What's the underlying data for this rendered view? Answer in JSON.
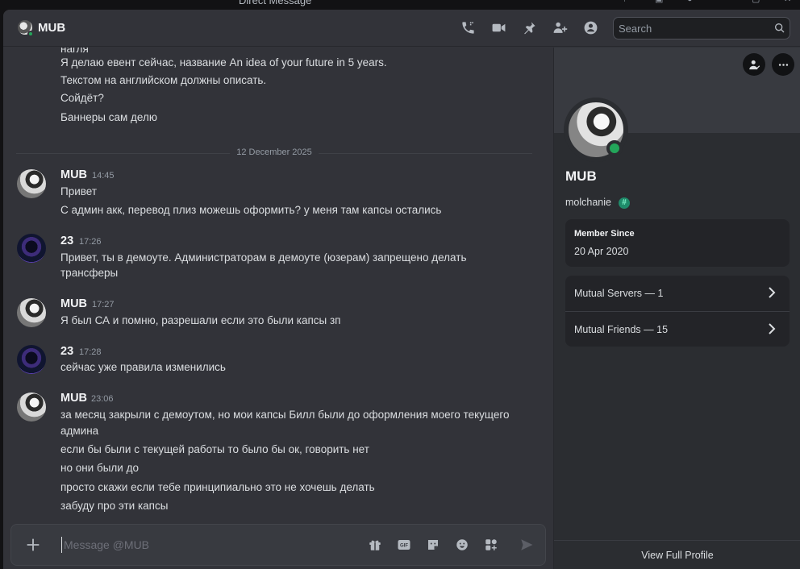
{
  "window": {
    "title": "Direct Message"
  },
  "header": {
    "name": "MUB",
    "icons": [
      "voice-call-icon",
      "video-call-icon",
      "pinned-messages-icon",
      "add-friends-to-dm-icon",
      "user-profile-icon"
    ],
    "search_placeholder": "Search"
  },
  "messages": {
    "partial_lines": [
      "Я делаю евент сейчас, название An idea of your future in 5 years.",
      "Текстом на английском должны описать.",
      "Сойдёт?",
      "Баннеры сам делю"
    ],
    "date_divider": "12 December 2025",
    "groups": [
      {
        "author": "MUB",
        "time": "14:45",
        "lines": [
          "Привет",
          "С админ акк, перевод плиз можешь оформить? у меня там капсы остались"
        ]
      },
      {
        "author": "23",
        "time": "17:26",
        "lines": [
          "Привет, ты в демоуте. Администраторам в демоуте (юзерам) запрещено делать",
          "трансферы"
        ]
      },
      {
        "author": "MUB",
        "time": "17:27",
        "lines": [
          "Я был СА и помню, разрешали если это были капсы зп"
        ]
      },
      {
        "author": "23",
        "time": "17:28",
        "lines": [
          "сейчас уже правила изменились"
        ]
      },
      {
        "author": "MUB",
        "time": "23:06",
        "lines": [
          "за месяц закрыли с демоутом, но мои капсы Билл были до оформления моего текущего",
          "админа",
          "если бы были с текущей работы то было бы ок, говорить нет",
          "но они были до",
          "просто скажи если тебе принципиально это не хочешь делать",
          "забуду про эти капсы"
        ]
      }
    ]
  },
  "composer": {
    "placeholder": "Message @MUB",
    "icons": [
      "gift-icon",
      "gif-icon",
      "sticker-icon",
      "emoji-icon",
      "apps-icon",
      "send-icon"
    ]
  },
  "profile": {
    "display_name": "MUB",
    "username": "molchanie",
    "member_since_label": "Member Since",
    "member_since_value": "20 Apr 2020",
    "mutual_servers": "Mutual Servers — 1",
    "mutual_friends": "Mutual Friends — 15",
    "view_full_profile": "View Full Profile",
    "status_color": "#23a55a"
  }
}
